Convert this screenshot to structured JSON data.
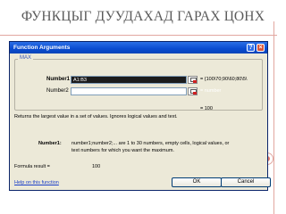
{
  "slide": {
    "title": "ФУНКЦЫГ ДУУДАХАД ГАРАХ ЦОНХ"
  },
  "dialog": {
    "title": "Function Arguments",
    "function_name": "MAX",
    "arguments": [
      {
        "label": "Number1",
        "value": "A1:B3",
        "result": "= {100\\70;90\\60;80\\5\\"
      },
      {
        "label": "Number2",
        "value": "",
        "result": "= number"
      }
    ],
    "overall_result": "= 100",
    "description": "Returns the largest value in a set of values. Ignores logical values and text.",
    "arg_description_name": "Number1:",
    "arg_description_line1": "number1;number2;... are 1 to 30 numbers, empty cells, logical values, or",
    "arg_description_line2": "text numbers for which you want the maximum.",
    "formula_result_label": "Formula result =",
    "formula_result_value": "100",
    "help_link": "Help on this function",
    "ok_label": "OK",
    "cancel_label": "Cancel"
  },
  "colors": {
    "title_bar": "#0a4bd0",
    "dialog_bg": "#ece9d8",
    "accent_decoration": "#e07a6e"
  }
}
